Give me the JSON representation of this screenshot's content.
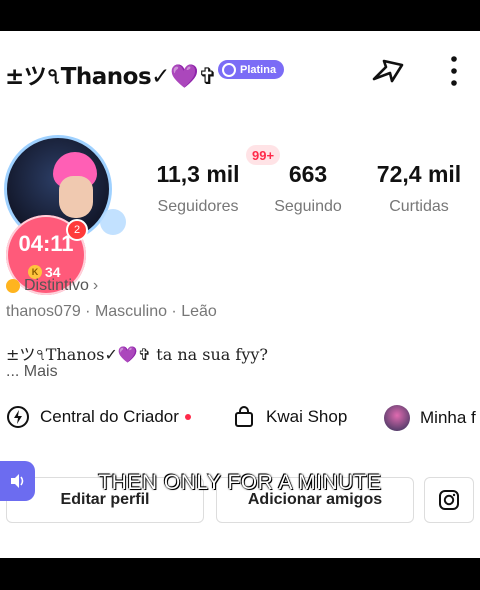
{
  "header": {
    "display_name": "±ツ৭Thanos✓💜✞",
    "badge_label": "Platina"
  },
  "avatar": {
    "timer": "04:11",
    "coins": "34",
    "notification_count": "2"
  },
  "stats": {
    "notification_badge": "99+",
    "items": [
      {
        "value": "11,3 mil",
        "label": "Seguidores"
      },
      {
        "value": "663",
        "label": "Seguindo"
      },
      {
        "value": "72,4 mil",
        "label": "Curtidas"
      }
    ]
  },
  "profile": {
    "distintivo_label": "Distintivo",
    "info_line": "thanos079  ·  Masculino  ·  Leão",
    "bio": "±ツ৭Thanos✓💜✞ ta na sua fyy?",
    "more_label": "...  Mais"
  },
  "links": {
    "creator_center": "Central do Criador",
    "kwai_shop": "Kwai Shop",
    "third": "Minha f"
  },
  "actions": {
    "edit_profile": "Editar perfil",
    "add_friends": "Adicionar amigos"
  },
  "overlay": {
    "subtitle": "THEN ONLY FOR A MINUTE"
  },
  "colors": {
    "accent_purple": "#7b6cf6",
    "timer_pink": "#ff5a7a",
    "notify_red": "#ff2a4a"
  }
}
